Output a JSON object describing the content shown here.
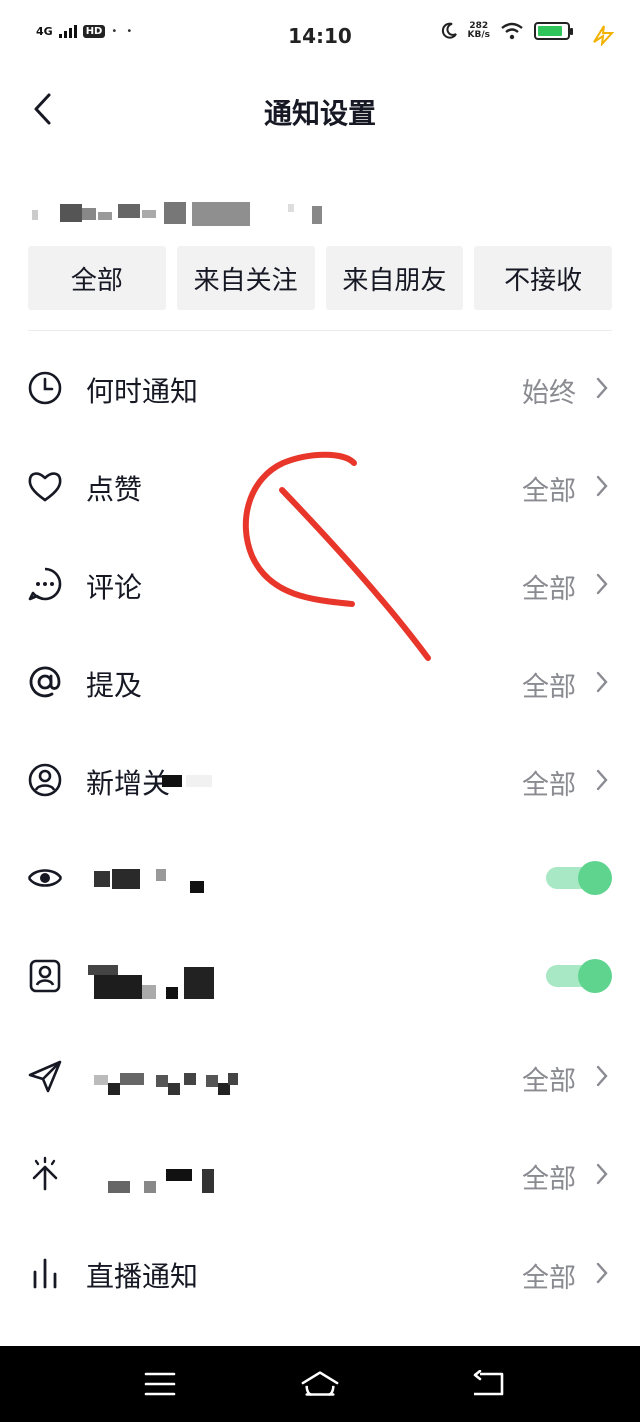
{
  "status_bar": {
    "network": "4G",
    "hd_badge": "HD",
    "dots": "• •",
    "time": "14:10",
    "net_speed_value": "282",
    "net_speed_unit": "KB/s",
    "battery_level": 0.85,
    "battery_color": "#2fc55a"
  },
  "header": {
    "title": "通知设置",
    "back_icon": "chevron-left-icon"
  },
  "filter_options": [
    "全部",
    "来自关注",
    "来自朋友",
    "不接收"
  ],
  "rows": [
    {
      "icon": "clock-icon",
      "label": "何时通知",
      "value": "始终",
      "control": "chevron"
    },
    {
      "icon": "heart-icon",
      "label": "点赞",
      "value": "全部",
      "control": "chevron"
    },
    {
      "icon": "comment-icon",
      "label": "评论",
      "value": "全部",
      "control": "chevron"
    },
    {
      "icon": "at-icon",
      "label": "提及",
      "value": "全部",
      "control": "chevron"
    },
    {
      "icon": "user-circle-icon",
      "label": "新增关",
      "value": "全部",
      "control": "chevron"
    },
    {
      "icon": "eye-icon",
      "label": "",
      "value": "",
      "control": "toggle",
      "on": true
    },
    {
      "icon": "contact-card-icon",
      "label": "",
      "value": "",
      "control": "toggle",
      "on": true
    },
    {
      "icon": "send-icon",
      "label": "",
      "value": "全部",
      "control": "chevron"
    },
    {
      "icon": "sparkle-icon",
      "label": "",
      "value": "全部",
      "control": "chevron"
    },
    {
      "icon": "bar-chart-icon",
      "label": "直播通知",
      "value": "全部",
      "control": "chevron"
    }
  ],
  "colors": {
    "accent_toggle": "#5fd48f",
    "annotation": "#e8362b",
    "value_text": "#8a8b91"
  },
  "nav": {
    "menu_icon": "menu-icon",
    "home_icon": "home-icon",
    "back_icon": "back-arrow-icon"
  }
}
